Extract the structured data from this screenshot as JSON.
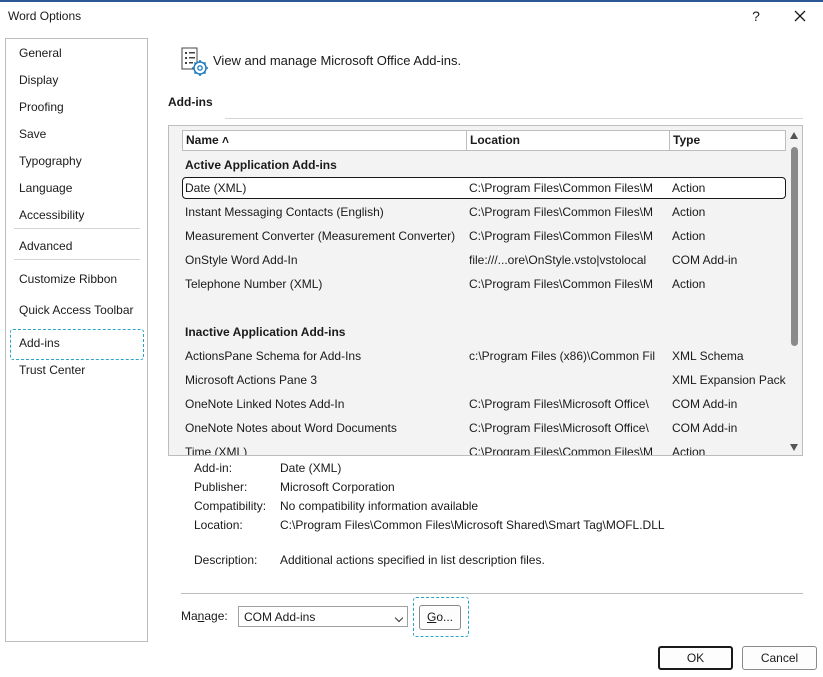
{
  "window": {
    "title": "Word Options",
    "help_glyph": "?",
    "close_icon": "close-icon"
  },
  "sidebar": {
    "items": [
      {
        "label": "General"
      },
      {
        "label": "Display"
      },
      {
        "label": "Proofing"
      },
      {
        "label": "Save"
      },
      {
        "label": "Typography"
      },
      {
        "label": "Language"
      },
      {
        "label": "Accessibility"
      },
      {
        "label": "Advanced"
      },
      {
        "label": "Customize Ribbon"
      },
      {
        "label": "Quick Access Toolbar"
      },
      {
        "label": "Add-ins",
        "selected": true
      },
      {
        "label": "Trust Center"
      }
    ]
  },
  "header": {
    "text": "View and manage Microsoft Office Add-ins.",
    "icon": "addins-gear-icon"
  },
  "section": {
    "title": "Add-ins"
  },
  "list": {
    "columns": [
      {
        "label": "Name ˄"
      },
      {
        "label": "Location"
      },
      {
        "label": "Type"
      }
    ],
    "groups": {
      "active": "Active Application Add-ins",
      "inactive": "Inactive Application Add-ins"
    },
    "active_rows": [
      {
        "name": "Date (XML)",
        "location": "C:\\Program Files\\Common Files\\M",
        "type": "Action"
      },
      {
        "name": "Instant Messaging Contacts (English)",
        "location": "C:\\Program Files\\Common Files\\M",
        "type": "Action"
      },
      {
        "name": "Measurement Converter (Measurement Converter)",
        "location": "C:\\Program Files\\Common Files\\M",
        "type": "Action"
      },
      {
        "name": "OnStyle Word Add-In",
        "location": "file:///...ore\\OnStyle.vsto|vstolocal",
        "type": "COM Add-in"
      },
      {
        "name": "Telephone Number (XML)",
        "location": "C:\\Program Files\\Common Files\\M",
        "type": "Action"
      }
    ],
    "inactive_rows": [
      {
        "name": "ActionsPane Schema for Add-Ins",
        "location": "c:\\Program Files (x86)\\Common Fil",
        "type": "XML Schema"
      },
      {
        "name": "Microsoft Actions Pane 3",
        "location": "",
        "type": "XML Expansion Pack"
      },
      {
        "name": "OneNote Linked Notes Add-In",
        "location": "C:\\Program Files\\Microsoft Office\\",
        "type": "COM Add-in"
      },
      {
        "name": "OneNote Notes about Word Documents",
        "location": "C:\\Program Files\\Microsoft Office\\",
        "type": "COM Add-in"
      },
      {
        "name": "Time (XML)",
        "location": "C:\\Program Files\\Common Files\\M",
        "type": "Action"
      }
    ]
  },
  "details": {
    "addin_label": "Add-in:",
    "addin_value": "Date (XML)",
    "publisher_label": "Publisher:",
    "publisher_value": "Microsoft Corporation",
    "compat_label": "Compatibility:",
    "compat_value": "No compatibility information available",
    "location_label": "Location:",
    "location_value": "C:\\Program Files\\Common Files\\Microsoft Shared\\Smart Tag\\MOFL.DLL",
    "description_label": "Description:",
    "description_value": "Additional actions specified in list description files."
  },
  "manage": {
    "label_pre": "Ma",
    "label_key": "n",
    "label_post": "age:",
    "selected": "COM Add-ins",
    "go_key": "G",
    "go_rest": "o..."
  },
  "buttons": {
    "ok": "OK",
    "cancel": "Cancel"
  }
}
